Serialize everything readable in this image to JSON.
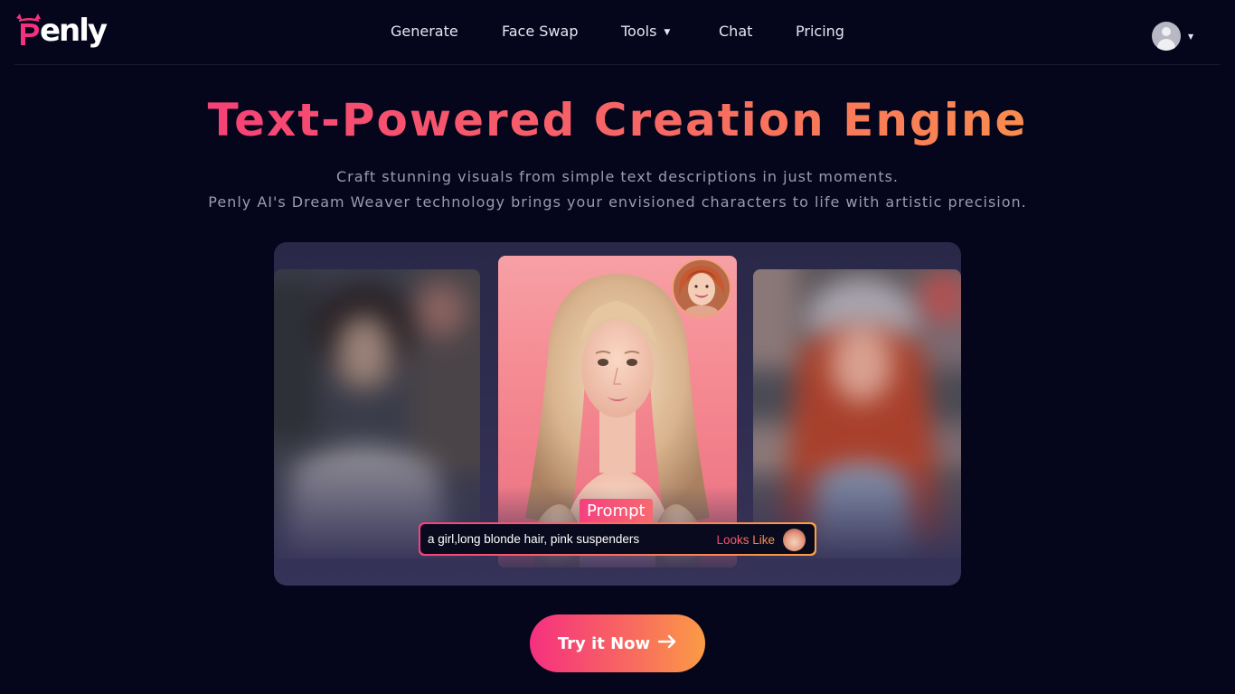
{
  "brand": {
    "logo_text": "enly",
    "logo_letter": "P"
  },
  "nav": {
    "items": [
      {
        "label": "Generate"
      },
      {
        "label": "Face Swap"
      },
      {
        "label": "Tools",
        "has_dropdown": true
      },
      {
        "label": "Chat"
      },
      {
        "label": "Pricing"
      }
    ]
  },
  "user": {
    "avatar_icon": "user-avatar-icon",
    "menu_icon": "caret-down-icon"
  },
  "hero": {
    "title": "Text-Powered Creation Engine",
    "subtitle_line1": "Craft stunning visuals from simple text descriptions in just moments.",
    "subtitle_line2": "Penly AI's Dream Weaver technology brings your envisioned characters to life with artistic precision."
  },
  "showcase": {
    "prompt_label": "Prompt",
    "prompt_text": "a girl,long blonde hair, pink suspenders",
    "looks_like_label": "Looks Like"
  },
  "cta": {
    "label": "Try it Now",
    "icon": "arrow-right-icon"
  },
  "colors": {
    "background": "#05051c",
    "accent_pink": "#f5307f",
    "accent_orange": "#fba043",
    "showcase_bg": "#2a2848"
  }
}
